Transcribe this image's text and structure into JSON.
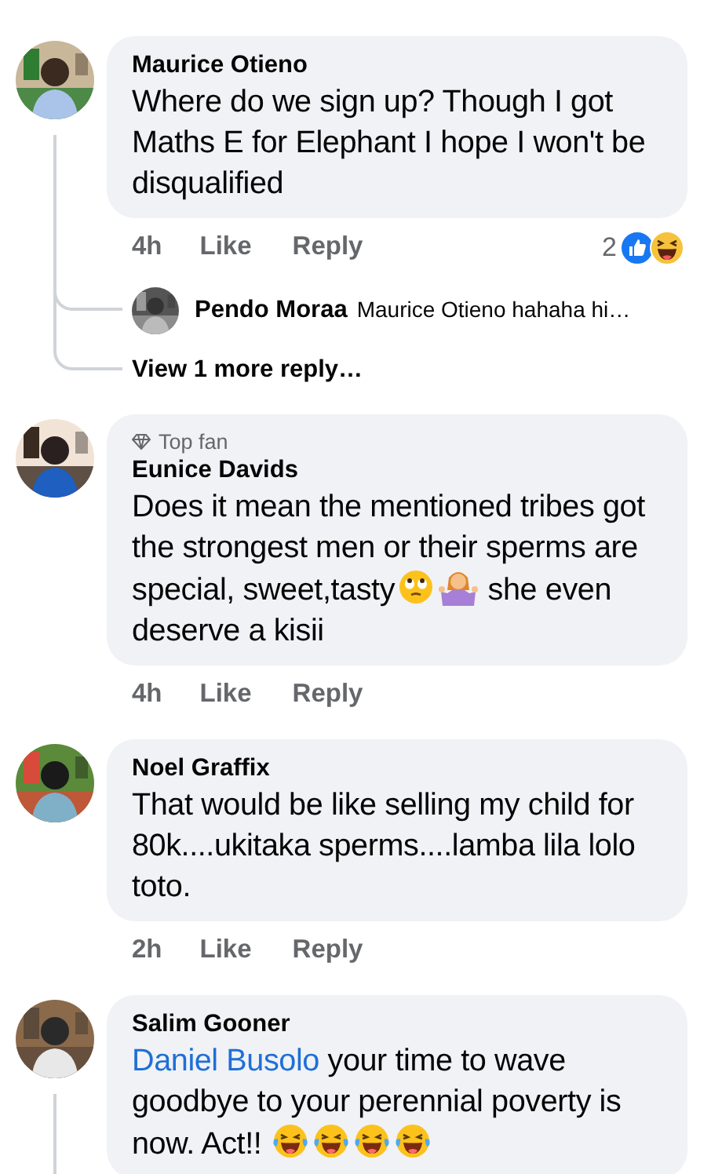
{
  "comments": [
    {
      "author": "Maurice Otieno",
      "thread_line": true,
      "body": [
        {
          "kind": "text",
          "text": "Where do we sign up? Though I got Maths E for Elephant I hope I won't be disqualified"
        }
      ],
      "time": "4h",
      "like": "Like",
      "reply": "Reply",
      "reaction_count": "2",
      "reactions": [
        {
          "kind": "like"
        },
        {
          "kind": "haha"
        }
      ],
      "replies": [
        {
          "author": "Pendo Moraa",
          "text": "Maurice Otieno hahaha hi…"
        }
      ],
      "more_replies": "View 1 more reply…"
    },
    {
      "author": "Eunice Davids",
      "badge": "Top fan",
      "body": [
        {
          "kind": "text",
          "text": "Does it mean the mentioned tribes got the strongest men or their sperms are special, sweet,tasty"
        },
        {
          "kind": "eyeroll"
        },
        {
          "kind": "shrug"
        },
        {
          "kind": "text",
          "text": " she even deserve a kisii"
        }
      ],
      "time": "4h",
      "like": "Like",
      "reply": "Reply"
    },
    {
      "author": "Noel Graffix",
      "body": [
        {
          "kind": "text",
          "text": "That would be like selling my child for 80k....ukitaka sperms....lamba lila lolo toto."
        }
      ],
      "time": "2h",
      "like": "Like",
      "reply": "Reply"
    },
    {
      "author": "Salim Gooner",
      "thread_line": true,
      "body": [
        {
          "kind": "mention",
          "text": "Daniel Busolo"
        },
        {
          "kind": "text",
          "text": " your time to wave goodbye to your perennial poverty is now. Act!! "
        },
        {
          "kind": "joy"
        },
        {
          "kind": "joy"
        },
        {
          "kind": "joy"
        },
        {
          "kind": "joy"
        }
      ]
    }
  ]
}
